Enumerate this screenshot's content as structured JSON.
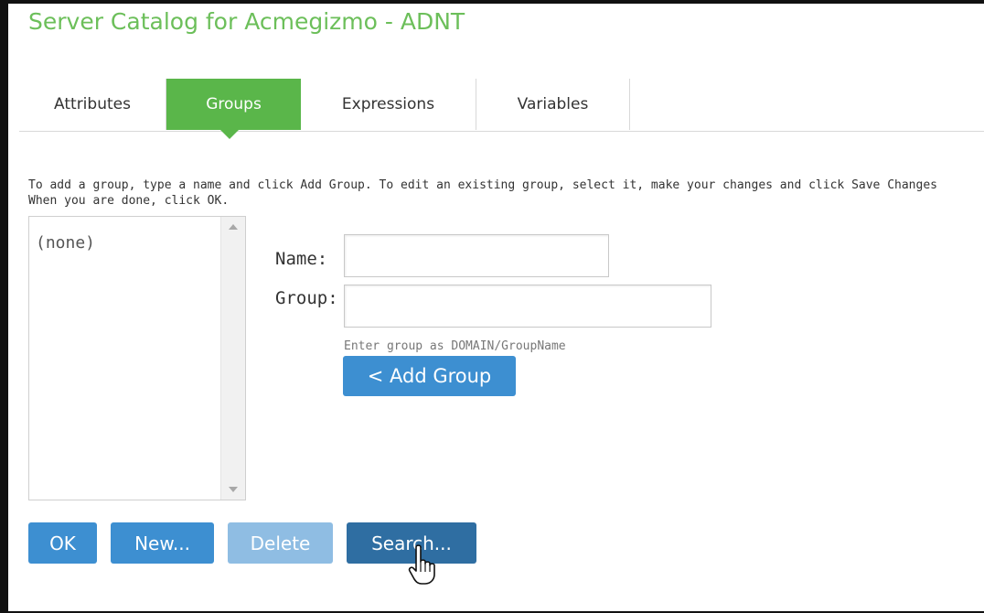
{
  "title": "Server Catalog for Acmegizmo - ADNT",
  "tabs": [
    {
      "label": "Attributes",
      "active": false
    },
    {
      "label": "Groups",
      "active": true
    },
    {
      "label": "Expressions",
      "active": false
    },
    {
      "label": "Variables",
      "active": false
    }
  ],
  "instructions": {
    "line1": "To add a group, type a name and click Add Group. To edit an existing group, select it, make your changes and click Save Changes",
    "line2": "When you are done, click OK."
  },
  "group_list": {
    "items": [
      "(none)"
    ]
  },
  "form": {
    "name_label": "Name:",
    "name_value": "",
    "group_label": "Group:",
    "group_value": "",
    "group_hint": "Enter group as DOMAIN/GroupName",
    "add_group_label": "< Add Group"
  },
  "buttons": {
    "ok": "OK",
    "new": "New...",
    "delete": "Delete",
    "search": "Search..."
  },
  "colors": {
    "brand_green": "#5ab64a",
    "title_green": "#6cbf5a",
    "button_blue": "#3d8fd1",
    "button_disabled": "#8fbde3",
    "button_hover": "#2f6ea2"
  },
  "icons": {
    "cursor": "hand-pointer-icon",
    "scroll_up": "chevron-up-icon",
    "scroll_down": "chevron-down-icon"
  }
}
